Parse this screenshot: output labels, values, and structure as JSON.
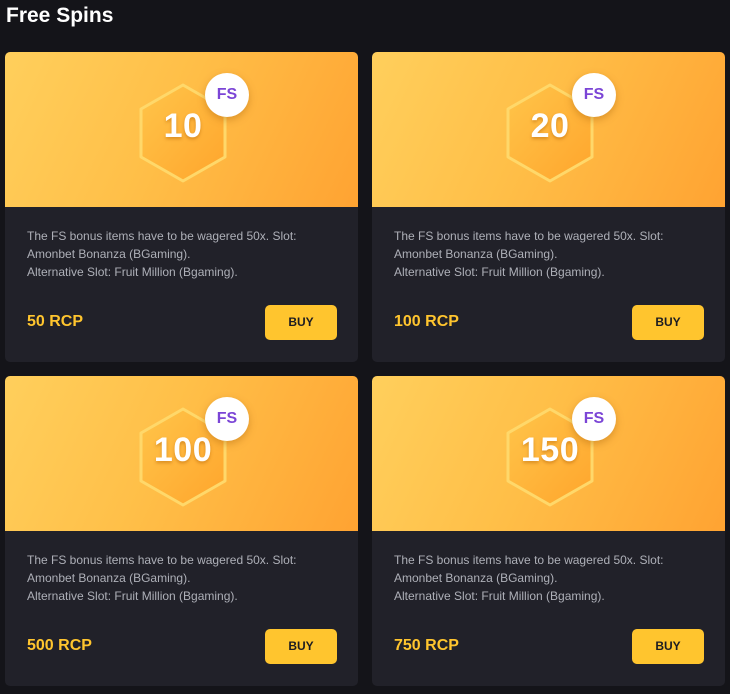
{
  "page": {
    "title": "Free Spins"
  },
  "theme": {
    "background": "#141419",
    "card_background": "#212129",
    "accent_yellow": "#ffc52e",
    "badge_text": "#7b45d6",
    "card_gradient": [
      "#ffcf5c",
      "#ffa332"
    ]
  },
  "icons": {
    "hexagon": "hexagon-icon",
    "badge": "fs-badge"
  },
  "cards": [
    {
      "spins": "10",
      "badge": "FS",
      "description_lines": [
        "The FS bonus items have to be wagered 50x. Slot:",
        "Amonbet Bonanza (BGaming).",
        "Alternative Slot: Fruit Million (Bgaming)."
      ],
      "price": "50 RCP",
      "button_label": "BUY"
    },
    {
      "spins": "20",
      "badge": "FS",
      "description_lines": [
        "The FS bonus items have to be wagered 50x. Slot:",
        "Amonbet Bonanza (BGaming).",
        "Alternative Slot: Fruit Million (Bgaming)."
      ],
      "price": "100 RCP",
      "button_label": "BUY"
    },
    {
      "spins": "100",
      "badge": "FS",
      "description_lines": [
        "The FS bonus items have to be wagered 50x. Slot:",
        "Amonbet Bonanza (BGaming).",
        "Alternative Slot: Fruit Million (Bgaming)."
      ],
      "price": "500 RCP",
      "button_label": "BUY"
    },
    {
      "spins": "150",
      "badge": "FS",
      "description_lines": [
        "The FS bonus items have to be wagered 50x. Slot:",
        "Amonbet Bonanza (BGaming).",
        "Alternative Slot: Fruit Million (Bgaming)."
      ],
      "price": "750 RCP",
      "button_label": "BUY"
    }
  ]
}
